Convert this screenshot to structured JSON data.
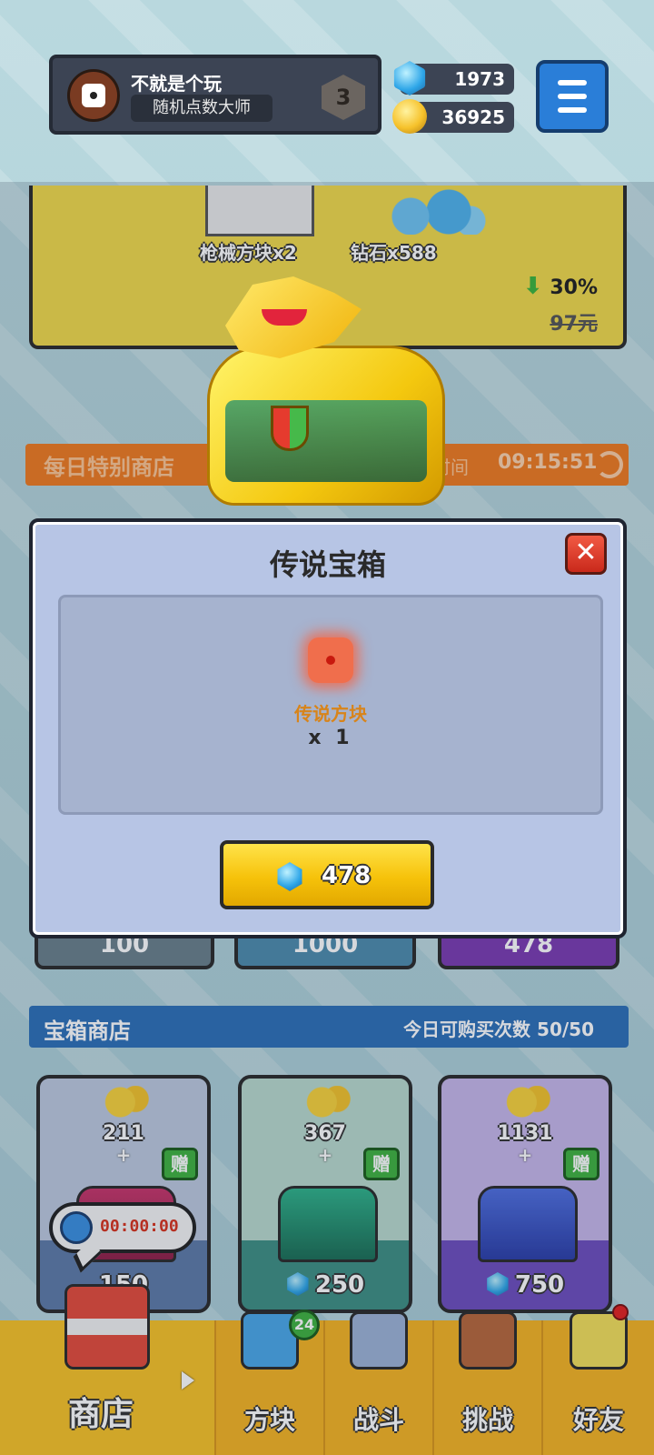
{
  "header": {
    "player_name": "不就是个玩",
    "player_title": "随机点数大师",
    "level": "3",
    "gems": "1973",
    "coins": "36925"
  },
  "featured_offer": {
    "item1_label": "枪械方块x2",
    "item2_label": "钻石x588",
    "discount": "30%",
    "old_price": "97元"
  },
  "daily_shop": {
    "title": "每日特别商店",
    "time_label": "时间",
    "timer": "09:15:51"
  },
  "price_strip": [
    "100",
    "1000",
    "478"
  ],
  "chest_shop": {
    "title": "宝箱商店",
    "purchases_label": "今日可购买次数",
    "purchases": "50/50",
    "cards": [
      {
        "coins": "211",
        "gift": "赠",
        "price": "150",
        "timer": "00:00:00"
      },
      {
        "coins": "367",
        "gift": "赠",
        "price": "250"
      },
      {
        "coins": "1131",
        "gift": "赠",
        "price": "750"
      }
    ]
  },
  "modal": {
    "title": "传说宝箱",
    "close": "✕",
    "reward_name": "传说方块",
    "reward_qty": "x 1",
    "buy_price": "478"
  },
  "nav": {
    "shop": "商店",
    "blocks": "方块",
    "blocks_badge": "24",
    "battle": "战斗",
    "challenge": "挑战",
    "friends": "好友"
  },
  "colors": {
    "modal_bg": "#b7c5e5",
    "buy_button": "#f6c20a",
    "close_button": "#c9291b",
    "nav_bg": "#f6b422"
  }
}
